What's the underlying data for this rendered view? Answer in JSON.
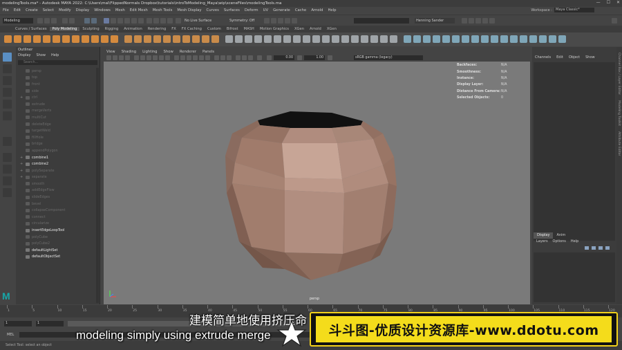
{
  "window": {
    "title": "modelingTools.ma* - Autodesk MAYA 2022: C:\\Users\\mal\\FlippedNormals Dropbox\\tutorials\\introToModeling_Maya\\wip\\sceneFiles\\modelingTools.ma"
  },
  "menubar": {
    "items": [
      "File",
      "Edit",
      "Create",
      "Select",
      "Modify",
      "Display",
      "Windows",
      "Mesh",
      "Edit Mesh",
      "Mesh Tools",
      "Mesh Display",
      "Curves",
      "Surfaces",
      "Deform",
      "UV",
      "Generate",
      "Cache",
      "Arnold",
      "Help"
    ],
    "workspace_label": "Workspace :",
    "workspace_value": "Maya Classic*"
  },
  "statusline": {
    "mode": "Modeling",
    "live_surface": "No Live Surface",
    "symmetry": "Symmetry: Off",
    "user": "Henning Sander"
  },
  "shelf": {
    "tabs": [
      "Curves / Surfaces",
      "Poly Modeling",
      "Sculpting",
      "Rigging",
      "Animation",
      "Rendering",
      "FX",
      "FX Caching",
      "Custom",
      "Bifrost",
      "MASH",
      "Motion Graphics",
      "XGen",
      "Arnold",
      "XGen"
    ],
    "active_tab": "Poly Modeling"
  },
  "outliner": {
    "title": "Outliner",
    "menu": [
      "Display",
      "Show",
      "Help"
    ],
    "search_placeholder": "Search...",
    "items": [
      {
        "label": "persp",
        "state": "dim",
        "expand": ""
      },
      {
        "label": "top",
        "state": "dim",
        "expand": ""
      },
      {
        "label": "front",
        "state": "dim",
        "expand": ""
      },
      {
        "label": "side",
        "state": "dim",
        "expand": ""
      },
      {
        "label": "ctrl",
        "state": "dim",
        "expand": "+"
      },
      {
        "label": "extrude",
        "state": "dim",
        "expand": ""
      },
      {
        "label": "mergeVerts",
        "state": "dim",
        "expand": ""
      },
      {
        "label": "multiCut",
        "state": "dim",
        "expand": ""
      },
      {
        "label": "deleteEdge",
        "state": "dim",
        "expand": ""
      },
      {
        "label": "targetWeld",
        "state": "dim",
        "expand": ""
      },
      {
        "label": "fillHole",
        "state": "dim",
        "expand": ""
      },
      {
        "label": "bridge",
        "state": "dim",
        "expand": ""
      },
      {
        "label": "appendPolygon",
        "state": "dim",
        "expand": ""
      },
      {
        "label": "combine1",
        "state": "bright",
        "expand": "+"
      },
      {
        "label": "combine2",
        "state": "bright",
        "expand": "+"
      },
      {
        "label": "polySeparate",
        "state": "dim",
        "expand": "+"
      },
      {
        "label": "separate",
        "state": "dim",
        "expand": "+"
      },
      {
        "label": "smooth",
        "state": "dim",
        "expand": ""
      },
      {
        "label": "addEdgeFlow",
        "state": "dim",
        "expand": ""
      },
      {
        "label": "slideEdges",
        "state": "dim",
        "expand": ""
      },
      {
        "label": "bevel",
        "state": "dim",
        "expand": ""
      },
      {
        "label": "collapseComponent",
        "state": "dim",
        "expand": ""
      },
      {
        "label": "connect",
        "state": "dim",
        "expand": ""
      },
      {
        "label": "circularize",
        "state": "dim",
        "expand": ""
      },
      {
        "label": "insertEdgeLoopTool",
        "state": "bright",
        "expand": ""
      },
      {
        "label": "polyCube",
        "state": "dim",
        "expand": ""
      },
      {
        "label": "polyCube2",
        "state": "dim",
        "expand": ""
      },
      {
        "label": "defaultLightSet",
        "state": "bright",
        "expand": ""
      },
      {
        "label": "defaultObjectSet",
        "state": "bright",
        "expand": ""
      }
    ]
  },
  "viewport": {
    "menu": [
      "View",
      "Shading",
      "Lighting",
      "Show",
      "Renderer",
      "Panels"
    ],
    "near_clip": "0.00",
    "far_clip": "1.00",
    "color_space": "sRGB gamma (legacy)",
    "camera": "persp",
    "hud": [
      {
        "key": "Backfaces:",
        "value": "N/A"
      },
      {
        "key": "Smoothness:",
        "value": "N/A"
      },
      {
        "key": "Instance:",
        "value": "N/A"
      },
      {
        "key": "Display Layer:",
        "value": "N/A"
      },
      {
        "key": "Distance From Camera:",
        "value": "N/A"
      },
      {
        "key": "Selected Objects:",
        "value": "0"
      }
    ]
  },
  "channelbox": {
    "menu": [
      "Channels",
      "Edit",
      "Object",
      "Show"
    ],
    "layer_tabs": [
      "Display",
      "Anim"
    ],
    "layer_menu": [
      "Layers",
      "Options",
      "Help"
    ],
    "side_tabs": [
      "Channel Box / Layer Editor",
      "Modeling Toolkit",
      "Attribute Editor"
    ]
  },
  "timeline": {
    "labels": [
      "1",
      "5",
      "10",
      "15",
      "20",
      "25",
      "30",
      "35",
      "40",
      "45",
      "50",
      "55",
      "60",
      "65",
      "70",
      "75",
      "80",
      "85",
      "90",
      "95",
      "100",
      "105",
      "110",
      "115",
      "120"
    ],
    "start": "1",
    "current": "1"
  },
  "cmdline": {
    "label": "MEL",
    "help": "Select Tool: select an object"
  },
  "overlay": {
    "subtitle_cn": "建模简单地使用挤压命",
    "subtitle_en": "modeling simply using extrude merge",
    "banner_text": "斗斗图-优质设计资源库-www.ddotu.com",
    "banner_color": "#f4dc1b"
  }
}
